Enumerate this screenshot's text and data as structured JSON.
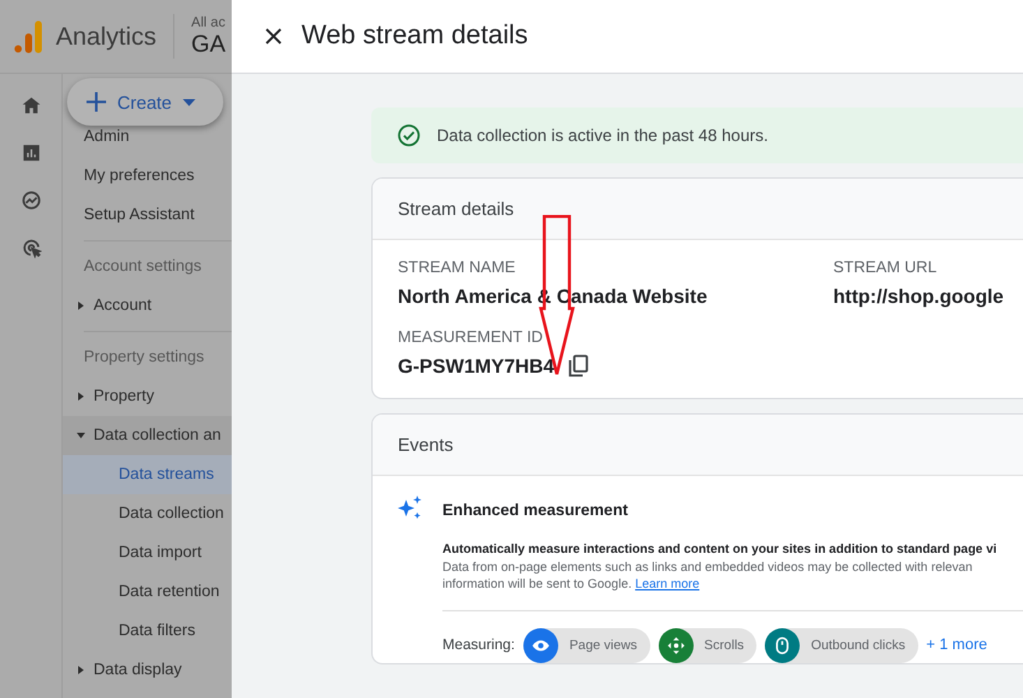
{
  "app": {
    "name": "Analytics",
    "account_label": "All ac",
    "account_name": "GA"
  },
  "rail": [
    {
      "kind": "home"
    },
    {
      "kind": "reports"
    },
    {
      "kind": "explore"
    },
    {
      "kind": "advertising"
    }
  ],
  "create_button": {
    "label": "Create"
  },
  "nav": [
    {
      "kind": "item",
      "label": "Admin",
      "selected": false
    },
    {
      "kind": "item",
      "label": "My preferences",
      "selected": false
    },
    {
      "kind": "item",
      "label": "Setup Assistant",
      "selected": false
    },
    {
      "kind": "divider"
    },
    {
      "kind": "header",
      "label": "Account settings"
    },
    {
      "kind": "group",
      "label": "Account",
      "expanded": false
    },
    {
      "kind": "divider"
    },
    {
      "kind": "header",
      "label": "Property settings"
    },
    {
      "kind": "group",
      "label": "Property",
      "expanded": false
    },
    {
      "kind": "group",
      "label": "Data collection an",
      "expanded": true
    },
    {
      "kind": "sub",
      "label": "Data streams",
      "selected": true
    },
    {
      "kind": "sub",
      "label": "Data collection",
      "selected": false
    },
    {
      "kind": "sub",
      "label": "Data import",
      "selected": false
    },
    {
      "kind": "sub",
      "label": "Data retention",
      "selected": false
    },
    {
      "kind": "sub",
      "label": "Data filters",
      "selected": false
    },
    {
      "kind": "group",
      "label": "Data display",
      "expanded": false
    }
  ],
  "panel": {
    "title": "Web stream details",
    "banner": "Data collection is active in the past 48 hours.",
    "stream_details": {
      "title": "Stream details",
      "fields": [
        {
          "label": "STREAM NAME",
          "value": "North America & Canada Website"
        },
        {
          "label": "STREAM URL",
          "value": "http://shop.google"
        }
      ],
      "measurement_id": {
        "label": "MEASUREMENT ID",
        "value": "G-PSW1MY7HB4"
      }
    },
    "events": {
      "title": "Events",
      "enhanced": {
        "title": "Enhanced measurement",
        "lines": [
          "Automatically measure interactions and content on your sites in addition to standard page vi",
          "Data from on-page elements such as links and embedded videos may be collected with relevan",
          "information will be sent to Google."
        ],
        "link": "Learn more",
        "measuring_label": "Measuring:",
        "chips": [
          {
            "kind": "eye",
            "label": "Page views",
            "color": "#1a73e8"
          },
          {
            "kind": "scroll",
            "label": "Scrolls",
            "color": "#188038"
          },
          {
            "kind": "mouse",
            "label": "Outbound clicks",
            "color": "#007b83"
          }
        ],
        "more": "+ 1 more"
      }
    }
  }
}
